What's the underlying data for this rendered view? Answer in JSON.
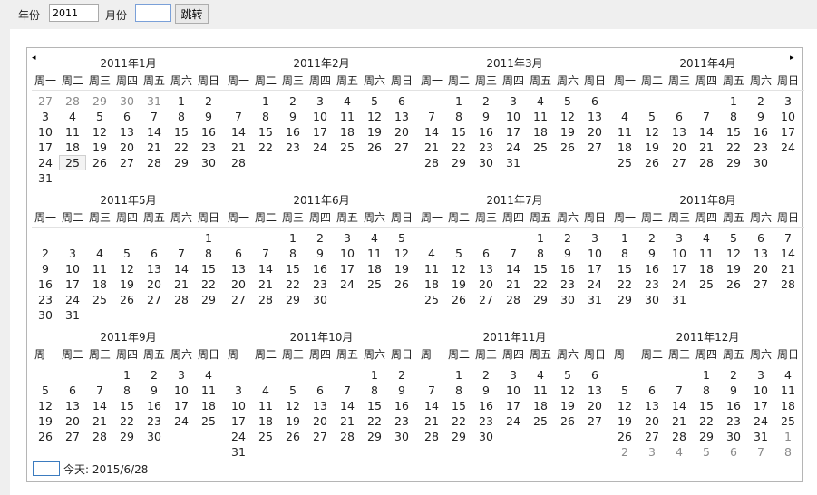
{
  "toolbar": {
    "year_label": "年份",
    "year_value": "2011",
    "month_label": "月份",
    "month_value": "",
    "go_label": "跳转"
  },
  "calendar": {
    "year": 2011,
    "weekdays": [
      "周一",
      "周二",
      "周三",
      "周四",
      "周五",
      "周六",
      "周日"
    ],
    "month_titles": [
      "2011年1月",
      "2011年2月",
      "2011年3月",
      "2011年4月",
      "2011年5月",
      "2011年6月",
      "2011年7月",
      "2011年8月",
      "2011年9月",
      "2011年10月",
      "2011年11月",
      "2011年12月"
    ],
    "prev_icon": "◂",
    "next_icon": "▸",
    "selected": {
      "month": 1,
      "day": 25
    },
    "leading_days": {
      "1": [
        "27",
        "28",
        "29",
        "30",
        "31"
      ]
    },
    "trailing_days": {
      "12": [
        "1",
        "2",
        "3",
        "4",
        "5",
        "6",
        "7",
        "8"
      ]
    }
  },
  "footer": {
    "today_label": "今天: 2015/6/28"
  }
}
